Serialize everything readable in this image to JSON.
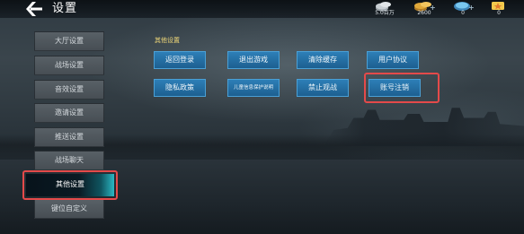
{
  "header": {
    "title": "设置",
    "back_icon": "back-arrow-icon",
    "resources": [
      {
        "name": "silver",
        "icon": "silver-coin-icon",
        "value": "5.0百万",
        "color": "#c9cfd4"
      },
      {
        "name": "gold",
        "icon": "gold-coin-icon",
        "value": "2600",
        "color": "#e0a83a"
      },
      {
        "name": "gem",
        "icon": "blue-gem-icon",
        "value": "0",
        "color": "#5fb8e8"
      },
      {
        "name": "ticket",
        "icon": "star-ticket-icon",
        "value": "0",
        "color": "#f2c94c"
      }
    ]
  },
  "sidebar": {
    "items": [
      {
        "label": "大厅设置"
      },
      {
        "label": "战场设置"
      },
      {
        "label": "音效设置"
      },
      {
        "label": "邀请设置"
      },
      {
        "label": "推送设置"
      },
      {
        "label": "战场聊天"
      },
      {
        "label": "其他设置",
        "active": true
      },
      {
        "label": "键位自定义"
      }
    ]
  },
  "main": {
    "section_title": "其他设置",
    "buttons": [
      {
        "label": "返回登录"
      },
      {
        "label": "退出游戏"
      },
      {
        "label": "清除缓存"
      },
      {
        "label": "用户协议"
      },
      {
        "label": "隐私政策"
      },
      {
        "label": "儿童信息保护说明"
      },
      {
        "label": "禁止观战"
      },
      {
        "label": "账号注销"
      }
    ]
  },
  "colors": {
    "button_blue": "#2d7fb7",
    "highlight_red": "#e44a4a",
    "active_cyan": "#2bb8c4",
    "section_title_yellow": "#f0d878"
  }
}
